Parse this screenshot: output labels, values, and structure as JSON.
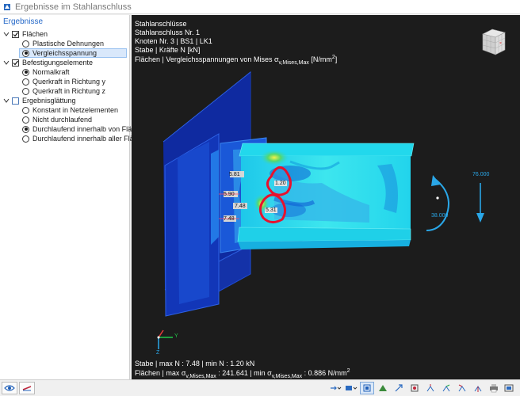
{
  "window": {
    "title": "Ergebnisse im Stahlanschluss"
  },
  "panel": {
    "header": "Ergebnisse",
    "groups": [
      {
        "label": "Flächen",
        "checked": true,
        "items": [
          {
            "label": "Plastische Dehnungen",
            "selected": false
          },
          {
            "label": "Vergleichsspannung",
            "selected": true
          }
        ]
      },
      {
        "label": "Befestigungselemente",
        "checked": true,
        "items": [
          {
            "label": "Normalkraft",
            "selected": true
          },
          {
            "label": "Querkraft in Richtung y",
            "selected": false
          },
          {
            "label": "Querkraft in Richtung z",
            "selected": false
          }
        ]
      },
      {
        "label": "Ergebnisglättung",
        "checked": false,
        "items": [
          {
            "label": "Konstant in Netzelementen",
            "selected": false
          },
          {
            "label": "Nicht durchlaufend",
            "selected": false
          },
          {
            "label": "Durchlaufend innerhalb von Flächen",
            "selected": true
          },
          {
            "label": "Durchlaufend innerhalb aller Flächen",
            "selected": false
          }
        ]
      }
    ]
  },
  "viewport": {
    "info_lines": [
      "Stahlanschlüsse",
      "Stahlanschluss Nr. 1",
      "Knoten Nr. 3 | BS1 | LK1",
      "Stabe | Kräfte N [kN]"
    ],
    "result_line_prefix": "Flächen | Vergleichsspannungen von Mises σ",
    "result_line_sub": "v,Mises,Max",
    "result_line_unit": " [N/mm",
    "result_line_sup": "2",
    "result_line_end": "]",
    "bolt_labels": [
      "5.81",
      "5.90",
      "7.48",
      "7.48",
      "1.20",
      "5.31"
    ],
    "load_values": {
      "force": "76.000",
      "moment": "38.000"
    },
    "axes": {
      "y": "Y",
      "z": "Z"
    },
    "footer_line1": "Stabe | max N : 7.48 | min N : 1.20 kN",
    "footer_line2_a": "Flächen | max σ",
    "footer_line2_sub1": "v,Mises,Max",
    "footer_line2_b": " : 241.641 | min σ",
    "footer_line2_sub2": "v,Mises,Max",
    "footer_line2_c": " : 0.886 N/mm",
    "footer_line2_sup": "2"
  },
  "colors": {
    "accent": "#2468c8",
    "highlight": "#e8112d",
    "load": "#2aa7e8"
  },
  "toolbar_icons": [
    "eye-icon",
    "result-line-icon",
    "arrow-dropdown-icon",
    "display-dropdown-icon",
    "view-toggle-icon",
    "render-icon",
    "arrow-tool-icon",
    "node-icon",
    "axis-x-icon",
    "axis-y-icon",
    "axis-z-icon",
    "axis-neg-icon",
    "print-icon",
    "settings-icon",
    "maximize-icon"
  ]
}
